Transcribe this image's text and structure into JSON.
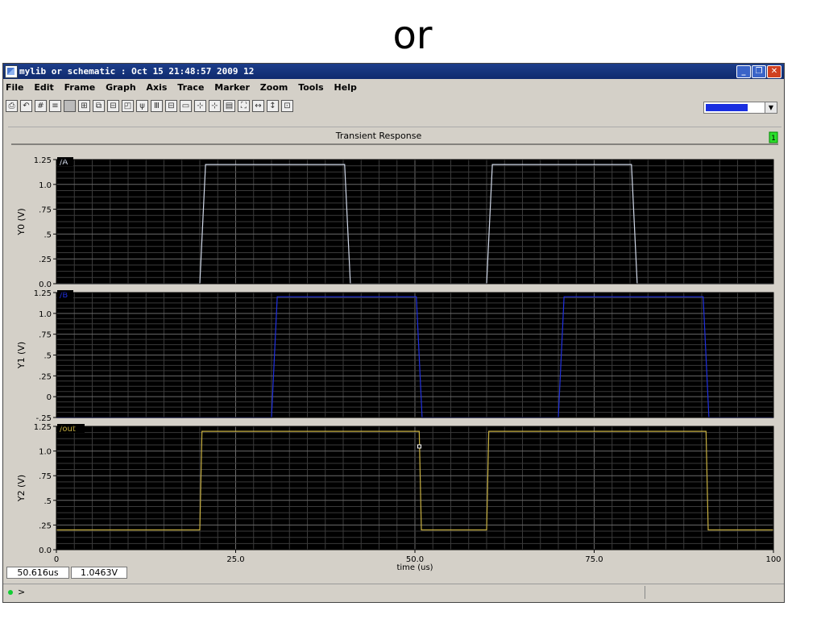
{
  "slide_title": "or",
  "window": {
    "title": "mylib or schematic : Oct 15 21:48:57 2009 12",
    "menu": [
      "File",
      "Edit",
      "Frame",
      "Graph",
      "Axis",
      "Trace",
      "Marker",
      "Zoom",
      "Tools",
      "Help"
    ]
  },
  "plot": {
    "title": "Transient Response",
    "badge": "1",
    "xlabel": "time (us)",
    "xticks": [
      "0",
      "25.0",
      "50.0",
      "75.0",
      "100"
    ]
  },
  "status": {
    "time": "50.616us",
    "value": "1.0463V"
  },
  "command_prompt": ">",
  "colors": {
    "A": "#d0d8e8",
    "B": "#2030e0",
    "out": "#c8b040",
    "plot_bg": "#000000"
  },
  "chart_data": [
    {
      "type": "line",
      "series": [
        {
          "name": "/A",
          "x": [
            0,
            20,
            20.8,
            40.2,
            41,
            60,
            60.8,
            80.2,
            81,
            100
          ],
          "y": [
            0,
            0,
            1.2,
            1.2,
            0,
            0,
            1.2,
            1.2,
            0,
            0
          ]
        }
      ],
      "ylabel": "Y0 (V)",
      "yticks": [
        "1.25",
        "1.0",
        ".75",
        ".5",
        ".25",
        "0.0"
      ],
      "ylim": [
        0,
        1.25
      ],
      "xlim": [
        0,
        100
      ]
    },
    {
      "type": "line",
      "series": [
        {
          "name": "/B",
          "x": [
            0,
            30,
            30.8,
            50.2,
            51,
            70,
            70.8,
            90.2,
            91,
            100
          ],
          "y": [
            -0.25,
            -0.25,
            1.2,
            1.2,
            -0.25,
            -0.25,
            1.2,
            1.2,
            -0.25,
            -0.25
          ]
        }
      ],
      "ylabel": "Y1 (V)",
      "yticks": [
        "1.25",
        "1.0",
        ".75",
        ".5",
        ".25",
        "0",
        "-.25"
      ],
      "ylim": [
        -0.25,
        1.25
      ],
      "xlim": [
        0,
        100
      ]
    },
    {
      "type": "line",
      "series": [
        {
          "name": "/out",
          "x": [
            0,
            20,
            20.3,
            50.6,
            50.9,
            60,
            60.3,
            90.6,
            90.9,
            100
          ],
          "y": [
            0.2,
            0.2,
            1.2,
            1.2,
            0.2,
            0.2,
            1.2,
            1.2,
            0.2,
            0.2
          ]
        }
      ],
      "ylabel": "Y2 (V)",
      "yticks": [
        "1.25",
        "1.0",
        ".75",
        ".5",
        ".25",
        "0.0"
      ],
      "ylim": [
        0,
        1.25
      ],
      "xlim": [
        0,
        100
      ],
      "marker": {
        "x": 50.616,
        "y": 1.0463
      }
    }
  ]
}
